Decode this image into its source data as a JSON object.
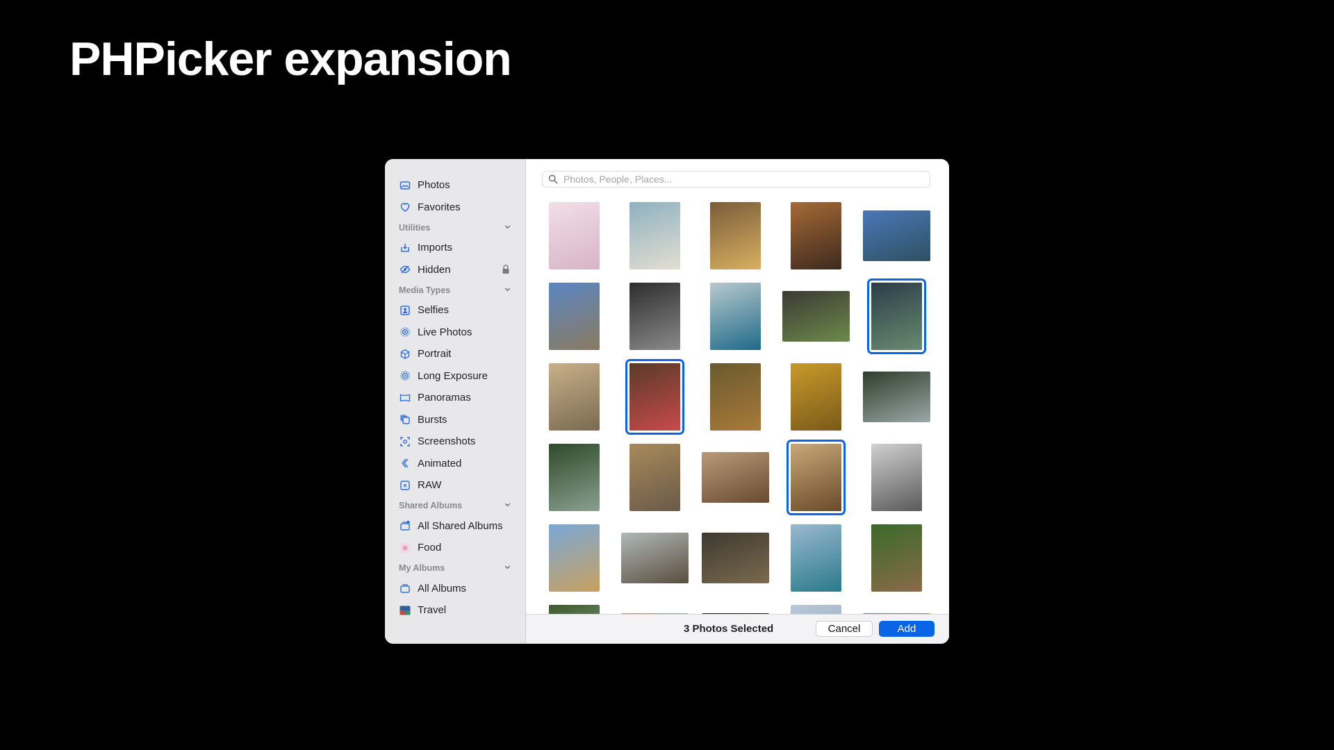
{
  "slide": {
    "title": "PHPicker expansion"
  },
  "colors": {
    "accent": "#0a64e6",
    "sidebar_bg": "#e8e8ea"
  },
  "sidebar": {
    "top_items": [
      {
        "label": "Photos",
        "icon": "photos-icon"
      },
      {
        "label": "Favorites",
        "icon": "heart-icon"
      }
    ],
    "sections": [
      {
        "title": "Utilities",
        "items": [
          {
            "label": "Imports",
            "icon": "import-icon"
          },
          {
            "label": "Hidden",
            "icon": "eye-slash-icon",
            "locked": true
          }
        ]
      },
      {
        "title": "Media Types",
        "items": [
          {
            "label": "Selfies",
            "icon": "selfie-icon"
          },
          {
            "label": "Live Photos",
            "icon": "live-photo-icon"
          },
          {
            "label": "Portrait",
            "icon": "cube-icon"
          },
          {
            "label": "Long Exposure",
            "icon": "long-exposure-icon"
          },
          {
            "label": "Panoramas",
            "icon": "panorama-icon"
          },
          {
            "label": "Bursts",
            "icon": "bursts-icon"
          },
          {
            "label": "Screenshots",
            "icon": "screenshot-icon"
          },
          {
            "label": "Animated",
            "icon": "animated-icon"
          },
          {
            "label": "RAW",
            "icon": "raw-icon"
          }
        ]
      },
      {
        "title": "Shared Albums",
        "items": [
          {
            "label": "All Shared Albums",
            "icon": "shared-albums-icon"
          },
          {
            "label": "Food",
            "icon": "food-album-icon"
          }
        ]
      },
      {
        "title": "My Albums",
        "items": [
          {
            "label": "All Albums",
            "icon": "albums-icon"
          },
          {
            "label": "Travel",
            "icon": "travel-album-icon"
          }
        ]
      }
    ]
  },
  "search": {
    "placeholder": "Photos, People, Places..."
  },
  "photos": [
    {
      "orient": "portrait",
      "colors": [
        "#f2dfe7",
        "#d7b4c6"
      ],
      "selected": false
    },
    {
      "orient": "portrait",
      "colors": [
        "#8fb1bf",
        "#e3ded2"
      ],
      "selected": false
    },
    {
      "orient": "portrait",
      "colors": [
        "#7a5c3a",
        "#d8b060"
      ],
      "selected": false
    },
    {
      "orient": "portrait",
      "colors": [
        "#a66a35",
        "#3d2a1e"
      ],
      "selected": false
    },
    {
      "orient": "landscape",
      "colors": [
        "#4a78b8",
        "#2e5060"
      ],
      "selected": false
    },
    {
      "orient": "portrait",
      "colors": [
        "#5b86c4",
        "#8a7a60"
      ],
      "selected": false
    },
    {
      "orient": "portrait",
      "colors": [
        "#2e2e2e",
        "#8a8a8a"
      ],
      "selected": false
    },
    {
      "orient": "portrait",
      "colors": [
        "#b8c9cc",
        "#1f6a8a"
      ],
      "selected": false
    },
    {
      "orient": "landscape",
      "colors": [
        "#3c3a34",
        "#6c8a4a"
      ],
      "selected": false
    },
    {
      "orient": "portrait",
      "colors": [
        "#2a3e48",
        "#6a8a70"
      ],
      "selected": true
    },
    {
      "orient": "portrait",
      "colors": [
        "#c8b08a",
        "#7a6a50"
      ],
      "selected": false
    },
    {
      "orient": "portrait",
      "colors": [
        "#5a3a2a",
        "#c84a4a"
      ],
      "selected": true
    },
    {
      "orient": "portrait",
      "colors": [
        "#6a5a2e",
        "#a87a3a"
      ],
      "selected": false
    },
    {
      "orient": "portrait",
      "colors": [
        "#c89a2a",
        "#7a5a1a"
      ],
      "selected": false
    },
    {
      "orient": "landscape",
      "colors": [
        "#2e3e2a",
        "#9aa8a8"
      ],
      "selected": false
    },
    {
      "orient": "portrait",
      "colors": [
        "#2e4a2a",
        "#8aa090"
      ],
      "selected": false
    },
    {
      "orient": "portrait",
      "colors": [
        "#a88a5a",
        "#6a5a4a"
      ],
      "selected": false
    },
    {
      "orient": "landscape",
      "colors": [
        "#b89a7a",
        "#6a4a2e"
      ],
      "selected": false
    },
    {
      "orient": "portrait",
      "colors": [
        "#c8a878",
        "#6a4a2a"
      ],
      "selected": true
    },
    {
      "orient": "portrait",
      "colors": [
        "#d0d0d0",
        "#5a5a5a"
      ],
      "selected": false
    },
    {
      "orient": "portrait",
      "colors": [
        "#7aa8d8",
        "#c8a060"
      ],
      "selected": false
    },
    {
      "orient": "landscape",
      "colors": [
        "#b0b8b8",
        "#5a4e3e"
      ],
      "selected": false
    },
    {
      "orient": "landscape",
      "colors": [
        "#3e3a30",
        "#7a6a50"
      ],
      "selected": false
    },
    {
      "orient": "portrait",
      "colors": [
        "#9ab8d0",
        "#2a7a8a"
      ],
      "selected": false
    },
    {
      "orient": "portrait",
      "colors": [
        "#3a6a2a",
        "#8a6a4a"
      ],
      "selected": false
    },
    {
      "orient": "portrait",
      "colors": [
        "#3e5a2e",
        "#9ab0a0"
      ],
      "selected": false
    },
    {
      "orient": "landscape",
      "colors": [
        "#7a9ab8",
        "#c0c8cc"
      ],
      "selected": false
    },
    {
      "orient": "landscape",
      "colors": [
        "#1a1a1a",
        "#4a3a30"
      ],
      "selected": false
    },
    {
      "orient": "portrait",
      "colors": [
        "#b8c8d8",
        "#8aa0b0"
      ],
      "selected": false
    },
    {
      "orient": "landscape",
      "colors": [
        "#4a86c0",
        "#a8c0d0"
      ],
      "selected": false
    }
  ],
  "footer": {
    "selected_text": "3 Photos Selected",
    "cancel_label": "Cancel",
    "add_label": "Add"
  }
}
